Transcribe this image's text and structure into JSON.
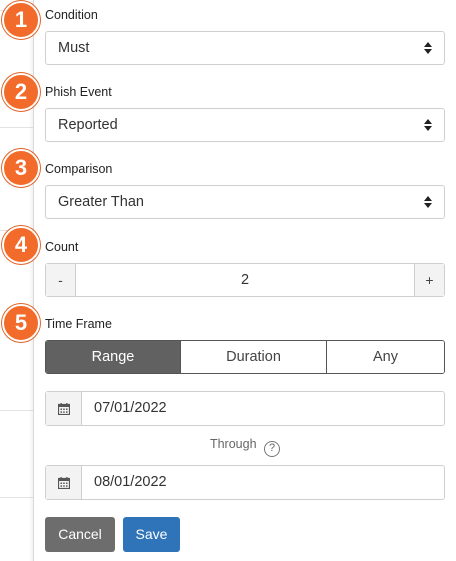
{
  "badges": [
    "1",
    "2",
    "3",
    "4",
    "5"
  ],
  "condition": {
    "label": "Condition",
    "value": "Must"
  },
  "phish_event": {
    "label": "Phish Event",
    "value": "Reported"
  },
  "comparison": {
    "label": "Comparison",
    "value": "Greater Than"
  },
  "count": {
    "label": "Count",
    "minus": "-",
    "value": "2",
    "plus": "+"
  },
  "time_frame": {
    "label": "Time Frame",
    "options": [
      "Range",
      "Duration",
      "Any"
    ],
    "selected": "Range"
  },
  "dates": {
    "start": "07/01/2022",
    "through_label": "Through",
    "help": "?",
    "end": "08/01/2022"
  },
  "actions": {
    "cancel": "Cancel",
    "save": "Save"
  },
  "colors": {
    "badge": "#f26b2a",
    "save": "#2f74b8",
    "cancel": "#6d6d6d",
    "active_segment": "#616161"
  },
  "icons": {
    "select_caret": "caret-up-down-icon",
    "calendar": "calendar-icon",
    "help": "help-circle-icon"
  }
}
